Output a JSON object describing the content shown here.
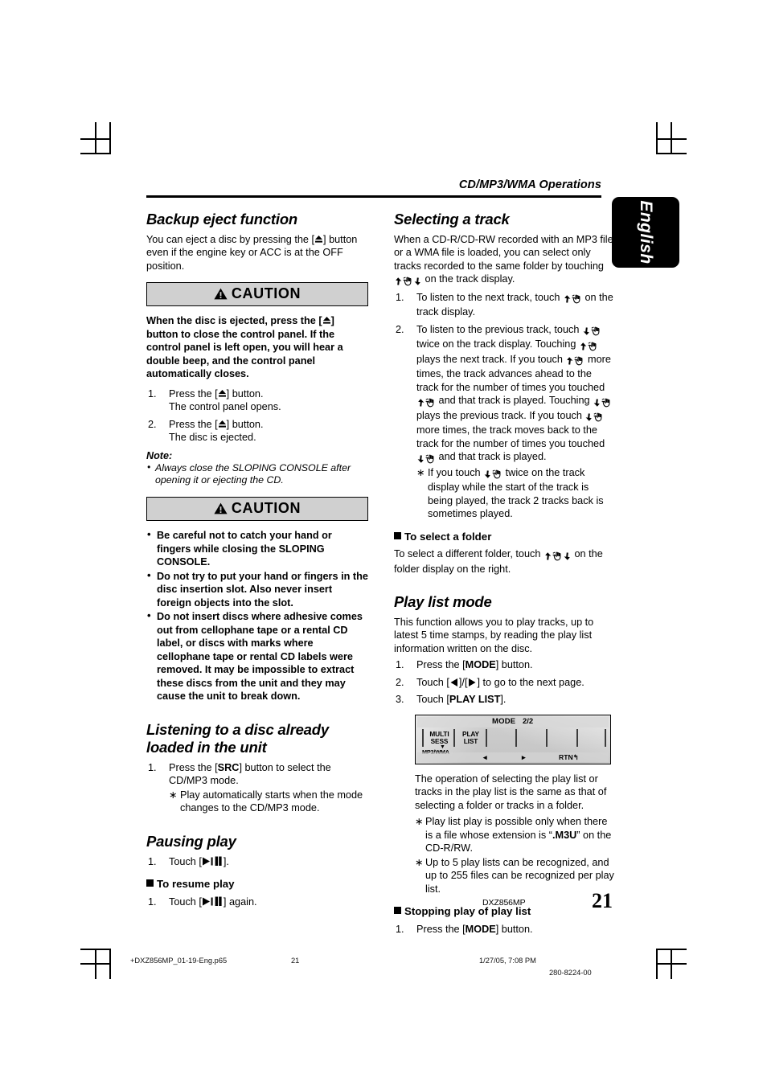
{
  "header": {
    "running_head": "CD/MP3/WMA Operations",
    "language_tab": "English"
  },
  "left_column": {
    "backup_eject": {
      "heading": "Backup eject function",
      "intro_a": "You can eject a disc by pressing the [",
      "intro_b": "] button even if the engine key or ACC is at the OFF position."
    },
    "caution1": {
      "label": "CAUTION",
      "body_a": "When the disc is ejected, press the [",
      "body_b": "] button to close the control panel. If the control panel is left open, you will hear a double beep, and the control panel automatically closes.",
      "steps": [
        {
          "n": "1.",
          "a": "Press the [",
          "b": "] button.",
          "c": "The control panel opens."
        },
        {
          "n": "2.",
          "a": "Press the [",
          "b": "] button.",
          "c": "The disc is ejected."
        }
      ],
      "note_label": "Note:",
      "note_items": [
        "Always close the SLOPING CONSOLE after opening it or ejecting the CD."
      ]
    },
    "caution2": {
      "label": "CAUTION",
      "bullets": [
        "Be careful not to catch your hand or fingers while closing the SLOPING CONSOLE.",
        "Do not try to put your hand or fingers in the disc insertion slot. Also never insert foreign objects into the slot.",
        "Do not insert discs where adhesive comes out from cellophane tape or a rental CD label, or discs with marks where cellophane tape or rental CD labels were removed. It may be impossible to extract these discs from the unit and they may cause the unit to break down."
      ]
    },
    "listening": {
      "heading": "Listening to a disc already loaded in the unit",
      "step1_n": "1.",
      "step1_a": "Press the [",
      "step1_key": "SRC",
      "step1_b": "] button to select the CD/MP3 mode.",
      "step1_note": "Play automatically starts when the mode changes to the CD/MP3 mode."
    },
    "pausing": {
      "heading": "Pausing play",
      "step1_n": "1.",
      "step1_a": "Touch [",
      "step1_b": "].",
      "resume_heading": "To resume play",
      "resume_n": "1.",
      "resume_a": "Touch [",
      "resume_b": "] again."
    }
  },
  "right_column": {
    "selecting_track": {
      "heading": "Selecting a track",
      "intro_a": "When a CD-R/CD-RW recorded with an MP3 file or a WMA file is loaded, you can select only tracks recorded to the same folder by touching ",
      "intro_b": " on the track display.",
      "step1_n": "1.",
      "step1_a": "To listen to the next track, touch ",
      "step1_b": " on the track display.",
      "step2_n": "2.",
      "step2_a": "To listen to the previous track, touch ",
      "step2_b": " twice on the track display.",
      "step2_c1": "Touching ",
      "step2_c2": " plays the next track. If you touch ",
      "step2_c3": " more times, the track advances ahead to the track for the number of times you touched ",
      "step2_c4": " and that track is played.",
      "step2_d1": "Touching ",
      "step2_d2": " plays the previous track. If you touch ",
      "step2_d3": " more times, the track moves back to the track for the number of times you touched ",
      "step2_d4": " and that track is played.",
      "step2_note_a": "If you touch ",
      "step2_note_b": " twice on the track display while the start of the track is being played, the track 2 tracks back is sometimes played.",
      "folder_heading": "To select a folder",
      "folder_text_a": "To select a different folder, touch ",
      "folder_text_b": " on the folder display on the right."
    },
    "play_list_mode": {
      "heading": "Play list mode",
      "intro": "This function allows you to play tracks, up to latest 5 time stamps, by reading the play list information written on the disc.",
      "steps": [
        {
          "n": "1.",
          "a": "Press the [",
          "key": "MODE",
          "b": "] button."
        },
        {
          "n": "2.",
          "a": "Touch [",
          "b": "]/[",
          "c": "] to go to the next page."
        },
        {
          "n": "3.",
          "a": "Touch [",
          "key": "PLAY LIST",
          "b": "]."
        }
      ],
      "display": {
        "mode_label": "MODE",
        "mode_page": "2/2",
        "key1_line1": "MULTI",
        "key1_line2": "SESS",
        "key2_line1": "PLAY",
        "key2_line2": "LIST",
        "format_label": "MP3/WMA",
        "format_marker": "▼",
        "nav_left": "◂",
        "nav_right": "▸",
        "return_label": "RTN",
        "return_arrow": "↰"
      },
      "after_text": "The operation of selecting the play list or tracks in the play list is the same as that of selecting a folder or tracks in a folder.",
      "notes": [
        {
          "a": "Play list play is possible only when there is a file whose extension is “",
          "key": ".M3U",
          "b": "” on the CD-R/RW."
        },
        {
          "a": "Up to 5 play lists can be recognized, and up to 255 files can be recognized per play list.",
          "key": "",
          "b": ""
        }
      ],
      "stopping_heading": "Stopping play of play list",
      "stopping_n": "1.",
      "stopping_a": "Press the [",
      "stopping_key": "MODE",
      "stopping_b": "] button."
    }
  },
  "footer": {
    "model_name": "DXZ856MP",
    "page_number": "21",
    "imprint_file": "+DXZ856MP_01-19-Eng.p65",
    "imprint_page": "21",
    "imprint_date": "1/27/05, 7:08 PM",
    "imprint_code": "280-8224-00"
  },
  "colors": {
    "caution_bg": "#d0d0d0",
    "tab_bg": "#000000",
    "text": "#000000"
  }
}
